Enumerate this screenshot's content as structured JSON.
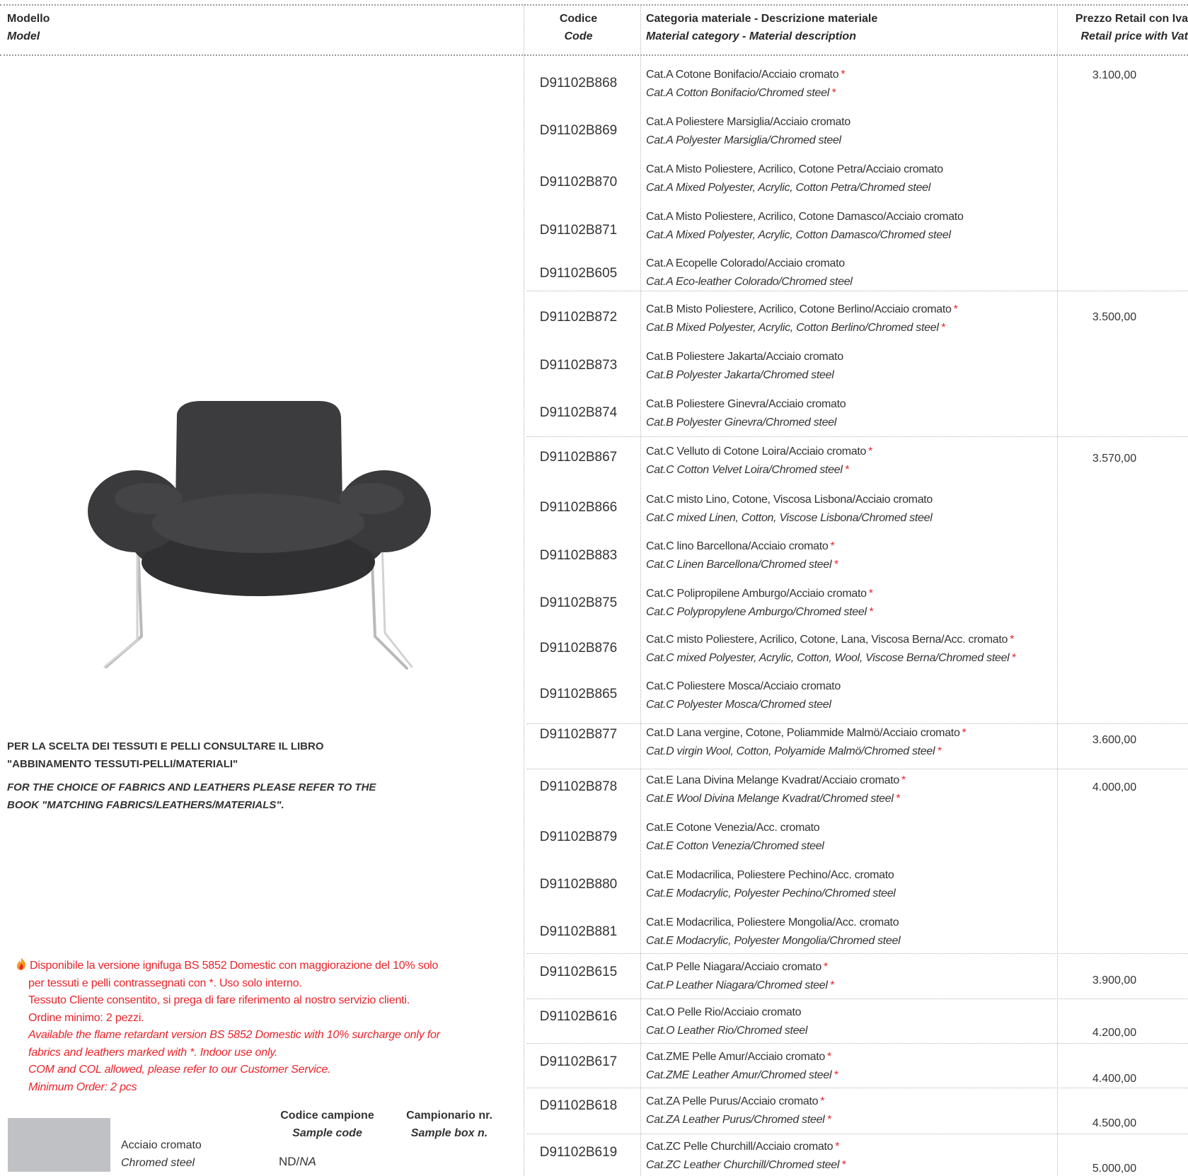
{
  "header": {
    "model_it": "Modello",
    "model_en": "Model",
    "code_it": "Codice",
    "code_en": "Code",
    "material_it": "Categoria materiale - Descrizione materiale",
    "material_en": "Material category - Material description",
    "price_it": "Prezzo Retail con Iva",
    "price_en": "Retail price with Vat"
  },
  "rows": [
    {
      "code": "D91102B868",
      "it": "Cat.A Cotone Bonifacio/Acciaio cromato",
      "en": "Cat.A Cotton Bonifacio/Chromed steel",
      "star": "*",
      "price": "3.100,00"
    },
    {
      "code": "D91102B869",
      "it": "Cat.A Poliestere Marsiglia/Acciaio cromato",
      "en": "Cat.A Polyester Marsiglia/Chromed steel",
      "star": "",
      "price": ""
    },
    {
      "code": "D91102B870",
      "it": "Cat.A Misto Poliestere, Acrilico, Cotone Petra/Acciaio cromato",
      "en": "Cat.A Mixed Polyester, Acrylic, Cotton Petra/Chromed steel",
      "star": "",
      "price": ""
    },
    {
      "code": "D91102B871",
      "it": "Cat.A Misto Poliestere, Acrilico, Cotone Damasco/Acciaio cromato",
      "en": "Cat.A Mixed Polyester, Acrylic, Cotton Damasco/Chromed steel",
      "star": "",
      "price": ""
    },
    {
      "code": "D91102B605",
      "it": "Cat.A Ecopelle Colorado/Acciaio cromato",
      "en": "Cat.A Eco-leather Colorado/Chromed steel",
      "star": "",
      "price": ""
    },
    {
      "code": "D91102B872",
      "it": "Cat.B Misto Poliestere, Acrilico, Cotone Berlino/Acciaio cromato",
      "en": "Cat.B Mixed Polyester, Acrylic, Cotton Berlino/Chromed steel",
      "star": "*",
      "price": "3.500,00"
    },
    {
      "code": "D91102B873",
      "it": "Cat.B Poliestere Jakarta/Acciaio cromato",
      "en": "Cat.B Polyester Jakarta/Chromed steel",
      "star": "",
      "price": ""
    },
    {
      "code": "D91102B874",
      "it": "Cat.B Poliestere Ginevra/Acciaio cromato",
      "en": "Cat.B Polyester Ginevra/Chromed steel",
      "star": "",
      "price": ""
    },
    {
      "code": "D91102B867",
      "it": "Cat.C Velluto di Cotone Loira/Acciaio cromato",
      "en": "Cat.C Cotton Velvet Loira/Chromed steel",
      "star": "*",
      "price": "3.570,00"
    },
    {
      "code": "D91102B866",
      "it": "Cat.C misto Lino, Cotone, Viscosa Lisbona/Acciaio cromato",
      "en": "Cat.C mixed Linen, Cotton, Viscose Lisbona/Chromed steel",
      "star": "",
      "price": ""
    },
    {
      "code": "D91102B883",
      "it": "Cat.C lino Barcellona/Acciaio cromato",
      "en": "Cat.C Linen Barcellona/Chromed steel",
      "star": "*",
      "price": ""
    },
    {
      "code": "D91102B875",
      "it": "Cat.C Polipropilene Amburgo/Acciaio cromato",
      "en": "Cat.C Polypropylene Amburgo/Chromed steel",
      "star": "*",
      "price": ""
    },
    {
      "code": "D91102B876",
      "it": "Cat.C misto Poliestere, Acrilico, Cotone, Lana, Viscosa Berna/Acc. cromato",
      "en": "Cat.C mixed Polyester, Acrylic, Cotton, Wool, Viscose Berna/Chromed steel",
      "star": "*",
      "price": ""
    },
    {
      "code": "D91102B865",
      "it": "Cat.C Poliestere Mosca/Acciaio cromato",
      "en": "Cat.C Polyester Mosca/Chromed steel",
      "star": "",
      "price": ""
    },
    {
      "code": "D91102B877",
      "it": "Cat.D Lana vergine, Cotone, Poliammide Malmö/Acciaio cromato",
      "en": "Cat.D virgin Wool, Cotton, Polyamide Malmö/Chromed steel",
      "star": "*",
      "price": "3.600,00"
    },
    {
      "code": "D91102B878",
      "it": "Cat.E Lana Divina Melange Kvadrat/Acciaio cromato",
      "en": "Cat.E Wool Divina Melange Kvadrat/Chromed steel",
      "star": "*",
      "price": "4.000,00"
    },
    {
      "code": "D91102B879",
      "it": "Cat.E Cotone Venezia/Acc. cromato",
      "en": "Cat.E Cotton Venezia/Chromed steel",
      "star": "",
      "price": ""
    },
    {
      "code": "D91102B880",
      "it": "Cat.E Modacrilica, Poliestere Pechino/Acc. cromato",
      "en": "Cat.E Modacrylic, Polyester Pechino/Chromed steel",
      "star": "",
      "price": ""
    },
    {
      "code": "D91102B881",
      "it": "Cat.E Modacrilica, Poliestere Mongolia/Acc. cromato",
      "en": "Cat.E Modacrylic, Polyester Mongolia/Chromed steel",
      "star": "",
      "price": ""
    },
    {
      "code": "D91102B615",
      "it": "Cat.P Pelle Niagara/Acciaio cromato",
      "en": "Cat.P Leather Niagara/Chromed steel",
      "star": "*",
      "price": "3.900,00"
    },
    {
      "code": "D91102B616",
      "it": "Cat.O Pelle Rio/Acciaio cromato",
      "en": "Cat.O Leather Rio/Chromed steel",
      "star": "",
      "price": "4.200,00"
    },
    {
      "code": "D91102B617",
      "it": "Cat.ZME Pelle Amur/Acciaio cromato",
      "en": "Cat.ZME Leather Amur/Chromed steel",
      "star": "*",
      "price": "4.400,00"
    },
    {
      "code": "D91102B618",
      "it": "Cat.ZA Pelle Purus/Acciaio cromato",
      "en": "Cat.ZA Leather Purus/Chromed steel",
      "star": "*",
      "price": "4.500,00"
    },
    {
      "code": "D91102B619",
      "it": "Cat.ZC Pelle Churchill/Acciaio cromato",
      "en": "Cat.ZC Leather Churchill/Chromed steel",
      "star": "*",
      "price": "5.000,00"
    }
  ],
  "notes": {
    "fabric_it_1": "PER LA SCELTA DEI TESSUTI E PELLI CONSULTARE IL LIBRO",
    "fabric_it_2": "\"ABBINAMENTO TESSUTI-PELLI/MATERIALI\"",
    "fabric_en_1": "FOR THE CHOICE OF FABRICS AND LEATHERS PLEASE REFER TO THE",
    "fabric_en_2": "BOOK \"MATCHING FABRICS/LEATHERS/MATERIALS\".",
    "flame_it_1": "Disponibile la versione ignifuga BS 5852 Domestic con maggiorazione del 10% solo",
    "flame_it_2": "per tessuti e pelli contrassegnati con *. Uso solo interno.",
    "flame_it_3": "Tessuto Cliente consentito, si prega di fare riferimento al nostro servizio clienti.",
    "flame_it_4": "Ordine minimo: 2 pezzi.",
    "flame_en_1": "Available the flame retardant version BS 5852 Domestic with 10% surcharge only for",
    "flame_en_2": "fabrics and leathers marked with *. Indoor use only.",
    "flame_en_3": "COM and COL allowed, please refer to our Customer Service.",
    "flame_en_4": "Minimum Order: 2 pcs"
  },
  "sample": {
    "finish_it": "Acciaio cromato",
    "finish_en": "Chromed steel",
    "code_head_it": "Codice campione",
    "code_head_en": "Sample code",
    "box_head_it": "Campionario nr.",
    "box_head_en": "Sample box n.",
    "code_value_it": "ND/",
    "code_value_en": "NA"
  },
  "colors": {
    "accent_red": "#e8232a",
    "text": "#333333",
    "chair_fabric": "#3a3a3c",
    "swatch": "#bfc1c4"
  }
}
